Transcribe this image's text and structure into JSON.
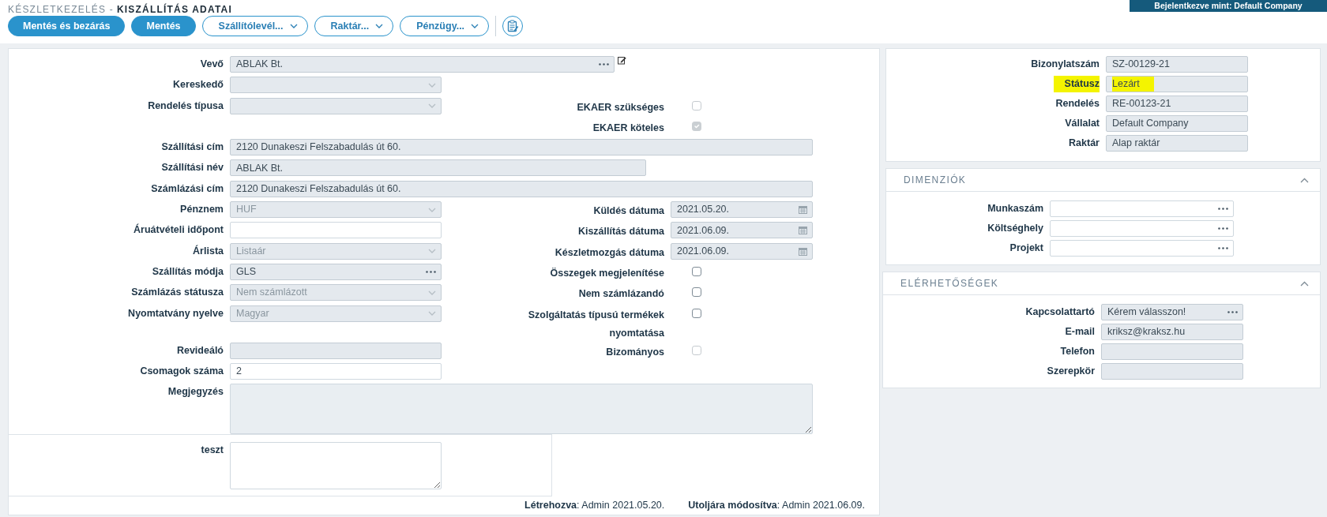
{
  "header": {
    "section": "KÉSZLETKEZELÉS -",
    "title": "KISZÁLLÍTÁS ADATAI",
    "user_banner": "Bejelentkezve mint: Default Company"
  },
  "toolbar": [
    {
      "kind": "primary",
      "label": "Mentés és bezárás"
    },
    {
      "kind": "primary",
      "label": "Mentés"
    },
    {
      "kind": "dropdown",
      "label": "Szállítólevél..."
    },
    {
      "kind": "dropdown",
      "label": "Raktár..."
    },
    {
      "kind": "dropdown",
      "label": "Pénzügy..."
    },
    {
      "kind": "icon"
    }
  ],
  "form": {
    "rows": [
      {
        "left": {
          "label": "Vevő",
          "kind": "lookup",
          "value": "ABLAK Bt.",
          "disabled": true,
          "edit_button": true
        }
      },
      {
        "left": {
          "label": "Kereskedő",
          "kind": "select",
          "disabled": true
        }
      },
      {
        "left": {
          "label": "Rendelés típusa",
          "kind": "select",
          "disabled": true
        },
        "right": {
          "label": "EKAER szükséges",
          "kind": "checkbox",
          "checked": false,
          "disabled": true
        }
      },
      {
        "right": {
          "label": "EKAER köteles",
          "kind": "checkbox",
          "checked": true,
          "disabled": true
        }
      },
      {
        "left": {
          "label": "Szállítási cím",
          "kind": "text",
          "value": "2120 Dunakeszi Felszabadulás út 60.",
          "disabled": true
        }
      },
      {
        "left": {
          "label": "Szállítási név",
          "kind": "text",
          "value": "ABLAK Bt.",
          "disabled": true
        }
      },
      {
        "left": {
          "label": "Számlázási cím",
          "kind": "text",
          "value": "2120 Dunakeszi Felszabadulás út 60.",
          "disabled": true
        }
      },
      {
        "left": {
          "label": "Pénznem",
          "kind": "select",
          "value": "HUF",
          "disabled": true
        },
        "right": {
          "label": "Küldés dátuma",
          "kind": "date",
          "value": "2021.05.20.",
          "disabled": true
        }
      },
      {
        "left": {
          "label": "Áruátvételi időpont",
          "kind": "text",
          "disabled": false
        },
        "right": {
          "label": "Kiszállítás dátuma",
          "kind": "date",
          "value": "2021.06.09.",
          "disabled": true
        }
      },
      {
        "left": {
          "label": "Árlista",
          "kind": "select",
          "value": "Listaár",
          "disabled": true
        },
        "right": {
          "label": "Készletmozgás dátuma",
          "kind": "date",
          "value": "2021.06.09.",
          "disabled": true
        }
      },
      {
        "left": {
          "label": "Szállítás módja",
          "kind": "lookup",
          "value": "GLS",
          "disabled": true
        },
        "right": {
          "label": "Összegek megjelenítése",
          "kind": "checkbox",
          "checked": false,
          "disabled": false
        }
      },
      {
        "left": {
          "label": "Számlázás státusza",
          "kind": "select",
          "value": "Nem számlázott",
          "disabled": true
        },
        "right": {
          "label": "Nem számlázandó",
          "kind": "checkbox",
          "checked": false,
          "disabled": false
        }
      },
      {
        "left": {
          "label": "Nyomtatvány nyelve",
          "kind": "select",
          "value": "Magyar",
          "disabled": true
        },
        "right": {
          "label": "Szolgáltatás típusú termékek nyomtatása",
          "kind": "checkbox",
          "checked": false,
          "disabled": false
        }
      },
      {
        "left": {
          "label": "Revideáló",
          "kind": "text",
          "disabled": true
        },
        "right": {
          "label": "Bizományos",
          "kind": "checkbox",
          "checked": false,
          "disabled": true
        }
      },
      {
        "left": {
          "label": "Csomagok száma",
          "kind": "text",
          "value": "2",
          "disabled": false
        }
      },
      {
        "left": {
          "label": "Megjegyzés",
          "kind": "textarea",
          "disabled": true
        }
      }
    ],
    "extra_box": {
      "label": "teszt",
      "kind": "textarea",
      "disabled": false
    },
    "footer": [
      "**Létrehozva**: Admin 2021.05.20.",
      "**Utoljára módosítva**: Admin 2021.06.09."
    ]
  },
  "document_info": {
    "fields": [
      {
        "label": "Bizonylatszám",
        "kind": "text",
        "value": "SZ-00129-21",
        "disabled": true
      },
      {
        "label": "Státusz",
        "kind": "text",
        "value": "Lezárt",
        "disabled": true,
        "highlighted": true
      },
      {
        "label": "Rendelés",
        "kind": "text",
        "value": "RE-00123-21",
        "disabled": true
      },
      {
        "label": "Vállalat",
        "kind": "text",
        "value": "Default Company",
        "disabled": true
      },
      {
        "label": "Raktár",
        "kind": "text",
        "value": "Alap raktár",
        "disabled": true
      }
    ]
  },
  "sections": [
    {
      "title": "DIMENZIÓK",
      "expanded": true,
      "fields": [
        {
          "label": "Munkaszám",
          "kind": "lookup",
          "disabled": false
        },
        {
          "label": "Költséghely",
          "kind": "lookup",
          "disabled": false
        },
        {
          "label": "Projekt",
          "kind": "lookup",
          "disabled": false
        }
      ]
    },
    {
      "title": "ELÉRHETŐSÉGEK",
      "expanded": true,
      "fields": [
        {
          "label": "Kapcsolattartó",
          "kind": "lookup",
          "value": "Kérem válasszon!",
          "disabled": true
        },
        {
          "label": "E-mail",
          "kind": "text",
          "value": "kriksz@kraksz.hu",
          "disabled": true
        },
        {
          "label": "Telefon",
          "kind": "text",
          "disabled": true
        },
        {
          "label": "Szerepkör",
          "kind": "text",
          "disabled": true
        }
      ]
    }
  ]
}
